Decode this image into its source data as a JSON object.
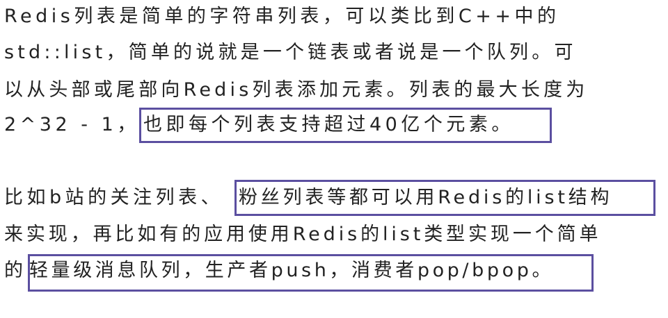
{
  "paragraph1": {
    "line1": "Redis列表是简单的字符串列表，可以类比到C++中的",
    "line2": "std::list，简单的说就是一个链表或者说是一个队列。可",
    "line3": "以从头部或尾部向Redis列表添加元素。列表的最大长度为",
    "line4_prefix": "2^32 - 1，",
    "line4_highlight": "也即每个列表支持超过40亿个元素。"
  },
  "paragraph2": {
    "line1_prefix": "比如b站的关注列表、",
    "line1_highlight": "粉丝列表等都可以用Redis的list结构",
    "line2": "来实现，再比如有的应用使用Redis的list类型实现一个简单",
    "line3_prefix": "的",
    "line3_highlight": "轻量级消息队列，生产者push，消费者pop/bpop。"
  },
  "colors": {
    "text": "#222222",
    "highlight_border": "#5b4fa0",
    "background": "#ffffff"
  }
}
